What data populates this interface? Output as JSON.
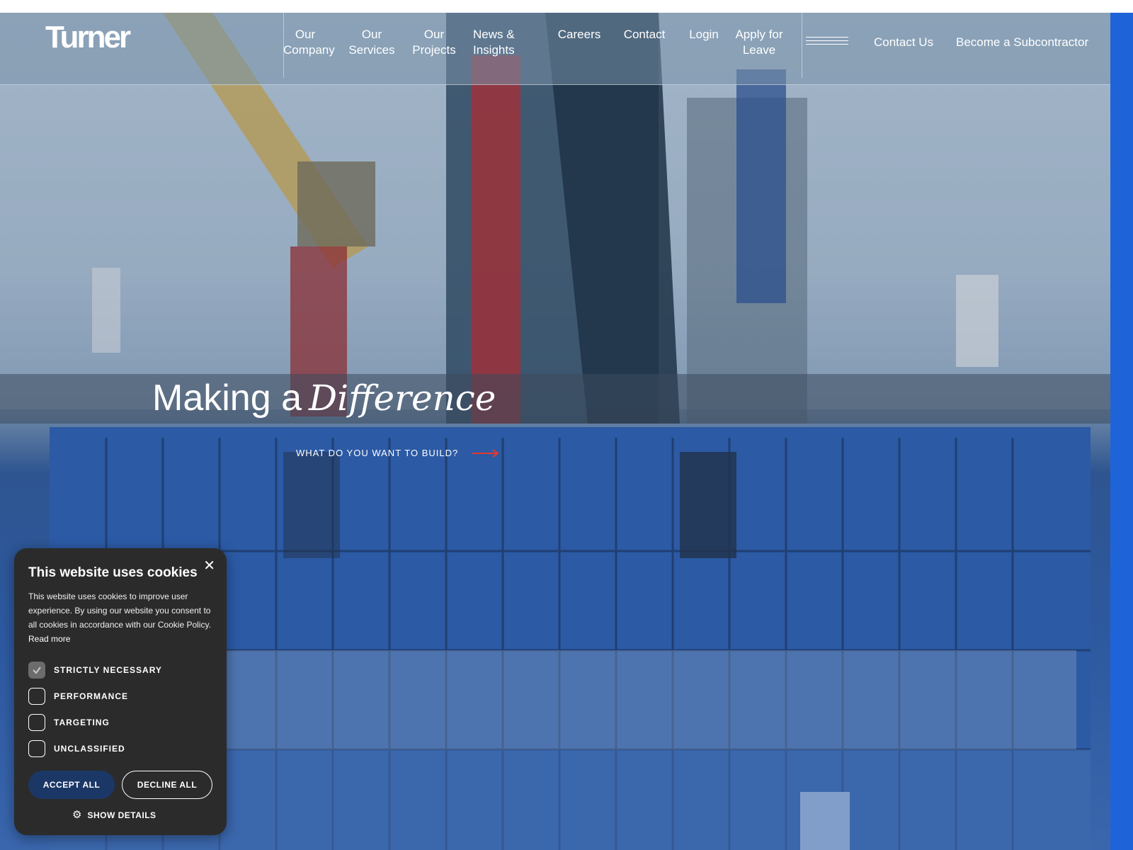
{
  "brand": {
    "logo_text": "Turner",
    "accent_color": "#e8372c",
    "strip_color": "#1f63d8"
  },
  "nav": {
    "items": [
      {
        "label": "Our\nCompany"
      },
      {
        "label": "Our\nServices"
      },
      {
        "label": "Our\nProjects"
      },
      {
        "label": "News &\nInsights"
      },
      {
        "label": "Careers"
      },
      {
        "label": "Contact"
      },
      {
        "label": "Login"
      },
      {
        "label": "Apply for\nLeave"
      }
    ],
    "menu_icon": "hamburger-icon",
    "contact_us": "Contact Us",
    "become_subcontractor": "Become a Subcontractor"
  },
  "hero": {
    "headline_plain": "Making a",
    "headline_script": "Difference",
    "cta_label": "WHAT DO YOU WANT TO BUILD?",
    "cta_icon": "arrow-right-icon"
  },
  "cookie_banner": {
    "title": "This website uses cookies",
    "body": "This website uses cookies to improve user experience. By using our website you consent to all cookies in accordance with our Cookie Policy.",
    "read_more": "Read more",
    "options": [
      {
        "label": "STRICTLY NECESSARY",
        "checked": true
      },
      {
        "label": "PERFORMANCE",
        "checked": false
      },
      {
        "label": "TARGETING",
        "checked": false
      },
      {
        "label": "UNCLASSIFIED",
        "checked": false
      }
    ],
    "accept_label": "ACCEPT ALL",
    "decline_label": "DECLINE ALL",
    "details_label": "SHOW DETAILS",
    "close_icon": "close-icon",
    "details_icon": "gear-icon"
  }
}
